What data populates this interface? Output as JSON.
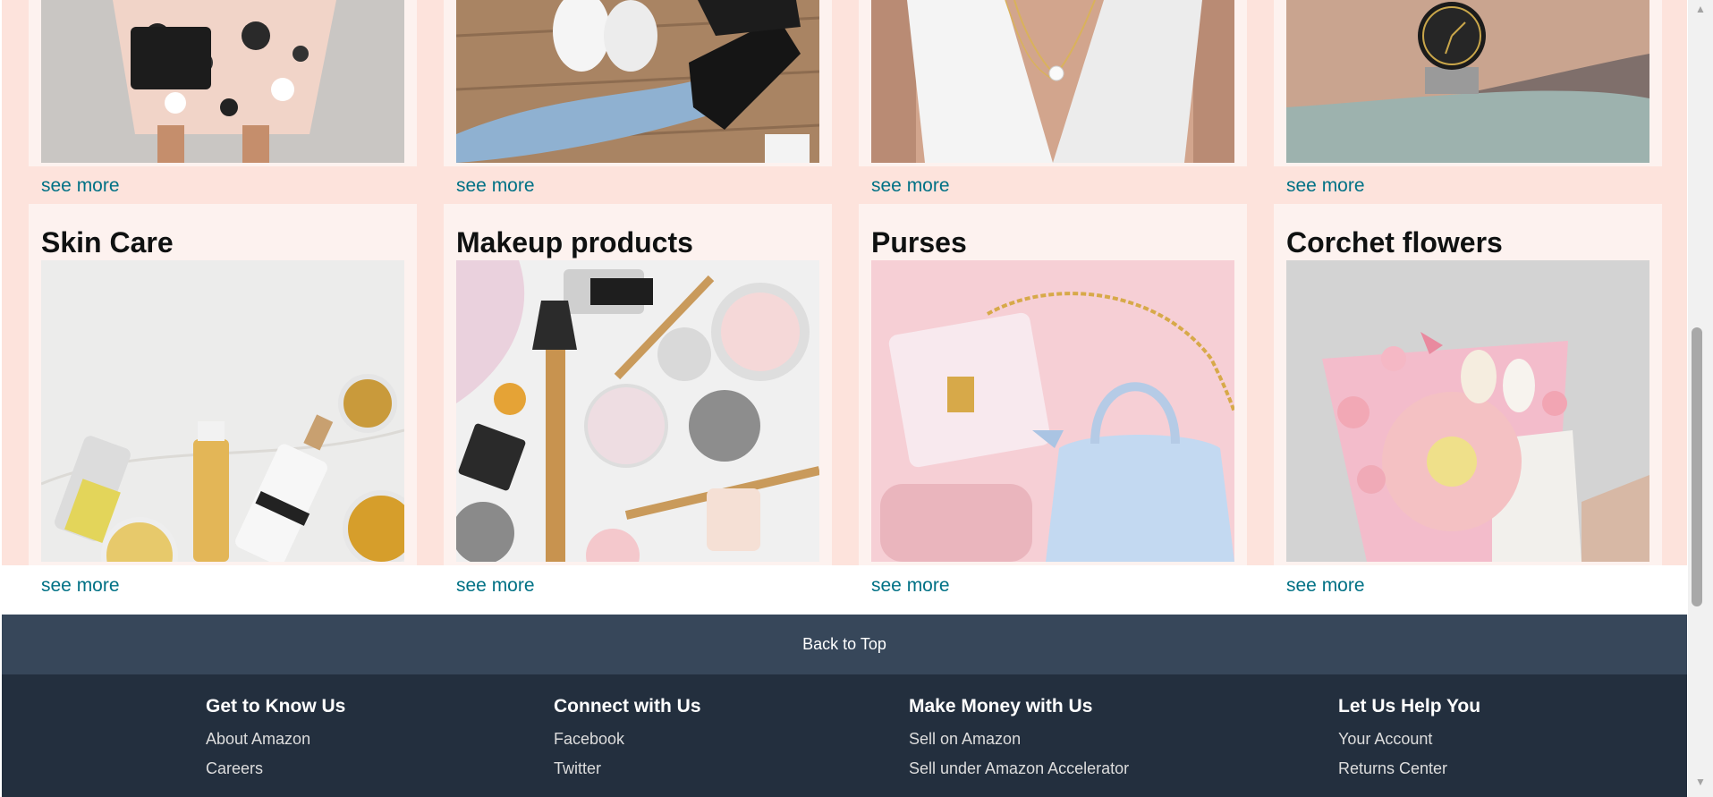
{
  "top_cards": [
    {
      "see_more": "see more"
    },
    {
      "see_more": "see more"
    },
    {
      "see_more": "see more"
    },
    {
      "see_more": "see more"
    }
  ],
  "bottom_cards": [
    {
      "title": "Skin Care",
      "see_more": "see more"
    },
    {
      "title": "Makeup products",
      "see_more": "see more"
    },
    {
      "title": "Purses",
      "see_more": "see more"
    },
    {
      "title": "Corchet flowers",
      "see_more": "see more"
    }
  ],
  "back_to_top": "Back to Top",
  "footer": {
    "columns": [
      {
        "heading": "Get to Know Us",
        "links": [
          "About Amazon",
          "Careers"
        ]
      },
      {
        "heading": "Connect with Us",
        "links": [
          "Facebook",
          "Twitter"
        ]
      },
      {
        "heading": "Make Money with Us",
        "links": [
          "Sell on Amazon",
          "Sell under Amazon Accelerator"
        ]
      },
      {
        "heading": "Let Us Help You",
        "links": [
          "Your Account",
          "Returns Center"
        ]
      }
    ]
  },
  "colors": {
    "band": "#fde3dc",
    "card": "#fdf2ef",
    "link": "#007185",
    "back_to_top_bg": "#37475a",
    "footer_bg": "#232f3e"
  },
  "icons": {
    "scroll_up": "scroll-up-arrow-icon",
    "scroll_down": "scroll-down-arrow-icon"
  }
}
